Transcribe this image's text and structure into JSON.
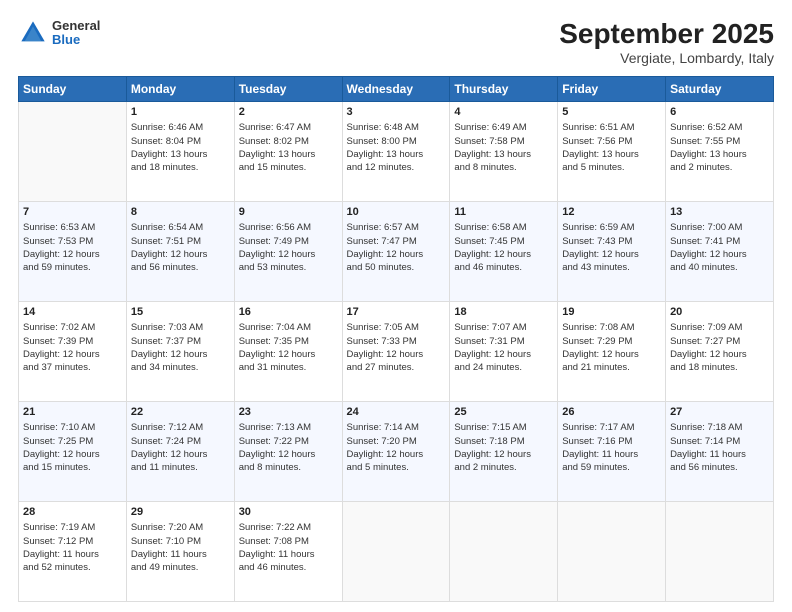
{
  "logo": {
    "general": "General",
    "blue": "Blue"
  },
  "title": "September 2025",
  "subtitle": "Vergiate, Lombardy, Italy",
  "days_header": [
    "Sunday",
    "Monday",
    "Tuesday",
    "Wednesday",
    "Thursday",
    "Friday",
    "Saturday"
  ],
  "weeks": [
    [
      {
        "day": "",
        "info": ""
      },
      {
        "day": "1",
        "info": "Sunrise: 6:46 AM\nSunset: 8:04 PM\nDaylight: 13 hours\nand 18 minutes."
      },
      {
        "day": "2",
        "info": "Sunrise: 6:47 AM\nSunset: 8:02 PM\nDaylight: 13 hours\nand 15 minutes."
      },
      {
        "day": "3",
        "info": "Sunrise: 6:48 AM\nSunset: 8:00 PM\nDaylight: 13 hours\nand 12 minutes."
      },
      {
        "day": "4",
        "info": "Sunrise: 6:49 AM\nSunset: 7:58 PM\nDaylight: 13 hours\nand 8 minutes."
      },
      {
        "day": "5",
        "info": "Sunrise: 6:51 AM\nSunset: 7:56 PM\nDaylight: 13 hours\nand 5 minutes."
      },
      {
        "day": "6",
        "info": "Sunrise: 6:52 AM\nSunset: 7:55 PM\nDaylight: 13 hours\nand 2 minutes."
      }
    ],
    [
      {
        "day": "7",
        "info": "Sunrise: 6:53 AM\nSunset: 7:53 PM\nDaylight: 12 hours\nand 59 minutes."
      },
      {
        "day": "8",
        "info": "Sunrise: 6:54 AM\nSunset: 7:51 PM\nDaylight: 12 hours\nand 56 minutes."
      },
      {
        "day": "9",
        "info": "Sunrise: 6:56 AM\nSunset: 7:49 PM\nDaylight: 12 hours\nand 53 minutes."
      },
      {
        "day": "10",
        "info": "Sunrise: 6:57 AM\nSunset: 7:47 PM\nDaylight: 12 hours\nand 50 minutes."
      },
      {
        "day": "11",
        "info": "Sunrise: 6:58 AM\nSunset: 7:45 PM\nDaylight: 12 hours\nand 46 minutes."
      },
      {
        "day": "12",
        "info": "Sunrise: 6:59 AM\nSunset: 7:43 PM\nDaylight: 12 hours\nand 43 minutes."
      },
      {
        "day": "13",
        "info": "Sunrise: 7:00 AM\nSunset: 7:41 PM\nDaylight: 12 hours\nand 40 minutes."
      }
    ],
    [
      {
        "day": "14",
        "info": "Sunrise: 7:02 AM\nSunset: 7:39 PM\nDaylight: 12 hours\nand 37 minutes."
      },
      {
        "day": "15",
        "info": "Sunrise: 7:03 AM\nSunset: 7:37 PM\nDaylight: 12 hours\nand 34 minutes."
      },
      {
        "day": "16",
        "info": "Sunrise: 7:04 AM\nSunset: 7:35 PM\nDaylight: 12 hours\nand 31 minutes."
      },
      {
        "day": "17",
        "info": "Sunrise: 7:05 AM\nSunset: 7:33 PM\nDaylight: 12 hours\nand 27 minutes."
      },
      {
        "day": "18",
        "info": "Sunrise: 7:07 AM\nSunset: 7:31 PM\nDaylight: 12 hours\nand 24 minutes."
      },
      {
        "day": "19",
        "info": "Sunrise: 7:08 AM\nSunset: 7:29 PM\nDaylight: 12 hours\nand 21 minutes."
      },
      {
        "day": "20",
        "info": "Sunrise: 7:09 AM\nSunset: 7:27 PM\nDaylight: 12 hours\nand 18 minutes."
      }
    ],
    [
      {
        "day": "21",
        "info": "Sunrise: 7:10 AM\nSunset: 7:25 PM\nDaylight: 12 hours\nand 15 minutes."
      },
      {
        "day": "22",
        "info": "Sunrise: 7:12 AM\nSunset: 7:24 PM\nDaylight: 12 hours\nand 11 minutes."
      },
      {
        "day": "23",
        "info": "Sunrise: 7:13 AM\nSunset: 7:22 PM\nDaylight: 12 hours\nand 8 minutes."
      },
      {
        "day": "24",
        "info": "Sunrise: 7:14 AM\nSunset: 7:20 PM\nDaylight: 12 hours\nand 5 minutes."
      },
      {
        "day": "25",
        "info": "Sunrise: 7:15 AM\nSunset: 7:18 PM\nDaylight: 12 hours\nand 2 minutes."
      },
      {
        "day": "26",
        "info": "Sunrise: 7:17 AM\nSunset: 7:16 PM\nDaylight: 11 hours\nand 59 minutes."
      },
      {
        "day": "27",
        "info": "Sunrise: 7:18 AM\nSunset: 7:14 PM\nDaylight: 11 hours\nand 56 minutes."
      }
    ],
    [
      {
        "day": "28",
        "info": "Sunrise: 7:19 AM\nSunset: 7:12 PM\nDaylight: 11 hours\nand 52 minutes."
      },
      {
        "day": "29",
        "info": "Sunrise: 7:20 AM\nSunset: 7:10 PM\nDaylight: 11 hours\nand 49 minutes."
      },
      {
        "day": "30",
        "info": "Sunrise: 7:22 AM\nSunset: 7:08 PM\nDaylight: 11 hours\nand 46 minutes."
      },
      {
        "day": "",
        "info": ""
      },
      {
        "day": "",
        "info": ""
      },
      {
        "day": "",
        "info": ""
      },
      {
        "day": "",
        "info": ""
      }
    ]
  ]
}
